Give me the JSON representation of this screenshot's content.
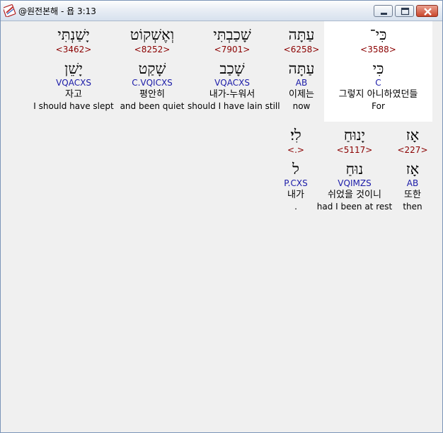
{
  "window": {
    "title": "@원전본해 - 욥 3:13"
  },
  "rows": [
    {
      "words": [
        {
          "hebrew": "כִּי־",
          "strong": "<3588>",
          "root": "כִּי",
          "morph": "C",
          "korean": "그렇지 아니하였던들",
          "english": "For"
        },
        {
          "hebrew": "עַתָּה",
          "strong": "<6258>",
          "root": "עַתָּה",
          "morph": "AB",
          "korean": "이제는",
          "english": "now"
        },
        {
          "hebrew": "שָׁכַבְתִּי",
          "strong": "<7901>",
          "root": "שָׁכַב",
          "morph": "VQACXS",
          "korean": "내가-누워서",
          "english": "should I have lain still"
        },
        {
          "hebrew": "וְאֶשְׁקוֹט",
          "strong": "<8252>",
          "root": "שָׁקַט",
          "morph": "C.VQICXS",
          "korean": "평안히",
          "english": "and been quiet"
        },
        {
          "hebrew": "יָשַׁנְתִּי",
          "strong": "<3462>",
          "root": "יָשֵׁן",
          "morph": "VQACXS",
          "korean": "자고",
          "english": "I should have slept"
        }
      ]
    },
    {
      "words": [
        {
          "hebrew": "אָז",
          "strong": "<227>",
          "root": "אָז",
          "morph": "AB",
          "korean": "또한",
          "english": "then"
        },
        {
          "hebrew": "יָנוּחַ",
          "strong": "<5117>",
          "root": "נוּחַ",
          "morph": "VQIMZS",
          "korean": "쉬었을 것이니",
          "english": "had I been at rest"
        },
        {
          "hebrew": "לִי׃",
          "strong": "<.>",
          "root": "ל",
          "morph": "P.CXS",
          "korean": "내가",
          "english": "."
        }
      ]
    }
  ]
}
